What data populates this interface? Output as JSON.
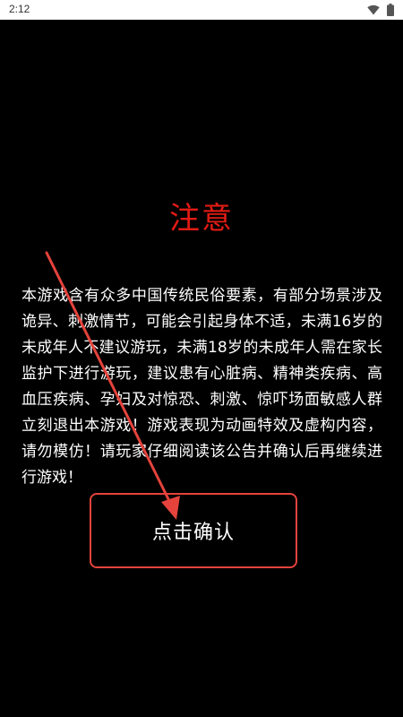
{
  "status_bar": {
    "time": "2:12",
    "icons": [
      "wifi-icon",
      "battery-icon"
    ],
    "background": "#ffffff"
  },
  "dialog": {
    "title": "注意",
    "title_color": "#e31b14",
    "message": "本游戏含有众多中国传统民俗要素，有部分场景涉及诡异、刺激情节，可能会引起身体不适，未满16岁的未成年人不建议游玩，未满18岁的未成年人需在家长监护下进行游玩，建议患有心脏病、精神类疾病、高血压疾病、孕妇及对惊恐、刺激、惊吓场面敏感人群立刻退出本游戏！游戏表现为动画特效及虚构内容，请勿模仿！请玩家仔细阅读该公告并确认后再继续进行游戏！",
    "confirm_label": "点击确认",
    "border_color": "#e5433c"
  },
  "annotation": {
    "icon": "pointer-arrow-icon",
    "color": "#e5433c"
  }
}
